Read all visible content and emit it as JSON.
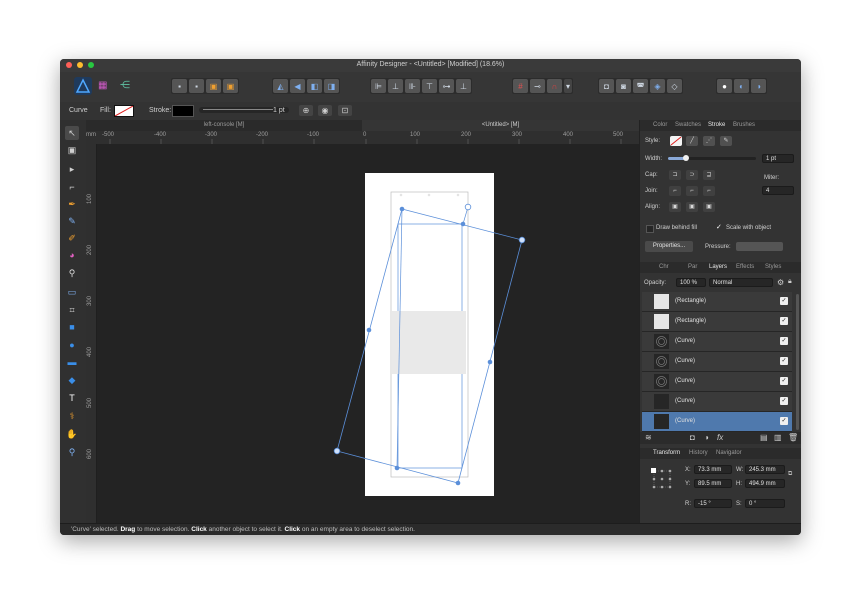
{
  "window": {
    "title": "Affinity Designer - <Untitled> [Modified] (18.6%)"
  },
  "colors": {
    "accent": "#4f79ad",
    "selection": "#5b8fd9",
    "canvas": "#232323"
  },
  "context_bar": {
    "object_type": "Curve",
    "fill_label": "Fill:",
    "stroke_label": "Stroke:",
    "stroke_width": "1 pt"
  },
  "doc_tabs": [
    "left-console [M]",
    "<Untitled> [M]"
  ],
  "ruler": {
    "unit": "mm",
    "h_labels": [
      "-500",
      "-400",
      "-300",
      "-200",
      "-100",
      "0",
      "100",
      "200",
      "300",
      "400",
      "500"
    ],
    "v_labels": [
      "100",
      "200",
      "300",
      "400",
      "500",
      "600"
    ]
  },
  "stroke_panel": {
    "tabs": [
      "Color",
      "Swatches",
      "Stroke",
      "Brushes"
    ],
    "active_tab": "Stroke",
    "style_label": "Style:",
    "width_label": "Width:",
    "width_value": "1 pt",
    "width_fraction": 0.2,
    "cap_label": "Cap:",
    "join_label": "Join:",
    "align_label": "Align:",
    "miter_label": "Miter:",
    "miter_value": "4",
    "draw_behind_fill": "Draw behind fill",
    "scale_with_object": "Scale with object",
    "properties_button": "Properties...",
    "pressure_label": "Pressure:"
  },
  "layers_panel": {
    "tabs": [
      "Chr",
      "Par",
      "Layers",
      "Effects",
      "Styles"
    ],
    "active_tab": "Layers",
    "opacity_label": "Opacity:",
    "opacity_value": "100 %",
    "blend_mode": "Normal",
    "layers": [
      {
        "name": "(Rectangle)",
        "thumb": "white",
        "selected": false
      },
      {
        "name": "(Rectangle)",
        "thumb": "white",
        "selected": false
      },
      {
        "name": "(Curve)",
        "thumb": "curve",
        "selected": false
      },
      {
        "name": "(Curve)",
        "thumb": "curve",
        "selected": false
      },
      {
        "name": "(Curve)",
        "thumb": "curve",
        "selected": false
      },
      {
        "name": "(Curve)",
        "thumb": "dark",
        "selected": false
      },
      {
        "name": "(Curve)",
        "thumb": "dark",
        "selected": true
      }
    ]
  },
  "transform_panel": {
    "tabs": [
      "Transform",
      "History",
      "Navigator"
    ],
    "active_tab": "Transform",
    "x_label": "X:",
    "x_value": "73.3 mm",
    "y_label": "Y:",
    "y_value": "89.5 mm",
    "w_label": "W:",
    "w_value": "245.3 mm",
    "h_label": "H:",
    "h_value": "494.9 mm",
    "r_label": "R:",
    "r_value": "-15 °",
    "s_label": "S:",
    "s_value": "0 °"
  },
  "status_bar": {
    "p1": "'Curve' selected. ",
    "b1": "Drag",
    "p2": " to move selection. ",
    "b2": "Click",
    "p3": " another object to select it. ",
    "b3": "Click",
    "p4": " on an empty area to deselect selection."
  }
}
